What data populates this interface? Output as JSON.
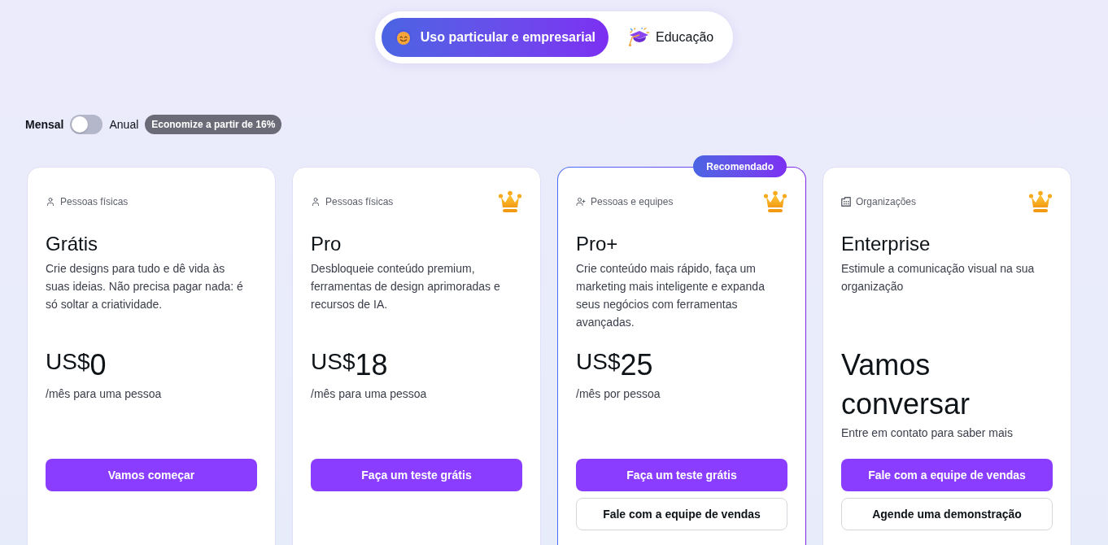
{
  "segments": [
    {
      "kind": "smiley",
      "label": "Uso particular e empresarial",
      "selected": true
    },
    {
      "kind": "graduation",
      "label": "Educação",
      "selected": false
    }
  ],
  "billing": {
    "left_label": "Mensal",
    "on": false,
    "right_label": "Anual",
    "badge": "Economize a partir de 16%"
  },
  "plans": [
    {
      "audience": {
        "kind": "person",
        "label": "Pessoas físicas"
      },
      "crown": false,
      "recommended": false,
      "name": "Grátis",
      "description": "Crie designs para tudo e dê vida às suas ideias. Não precisa pagar nada: é só soltar a criatividade.",
      "price": {
        "kind": "amount",
        "currency": "US$",
        "amount": "0"
      },
      "note": "/mês para uma pessoa",
      "buttons": [
        {
          "kind": "primary",
          "label": "Vamos começar"
        }
      ]
    },
    {
      "audience": {
        "kind": "person",
        "label": "Pessoas físicas"
      },
      "crown": true,
      "recommended": false,
      "name": "Pro",
      "description": "Desbloqueie conteúdo premium, ferramentas de design aprimoradas e recursos de IA.",
      "price": {
        "kind": "amount",
        "currency": "US$",
        "amount": "18"
      },
      "note": "/mês para uma pessoa",
      "buttons": [
        {
          "kind": "primary",
          "label": "Faça um teste grátis"
        }
      ]
    },
    {
      "badge": "Recomendado",
      "audience": {
        "kind": "person-plus",
        "label": "Pessoas e equipes"
      },
      "crown": true,
      "recommended": true,
      "name": "Pro+",
      "description": "Crie conteúdo mais rápido, faça um marketing mais inteligente e expanda seus negócios com ferramentas avançadas.",
      "price": {
        "kind": "amount",
        "currency": "US$",
        "amount": "25"
      },
      "note": "/mês por pessoa",
      "buttons": [
        {
          "kind": "primary",
          "label": "Faça um teste grátis"
        },
        {
          "kind": "secondary",
          "label": "Fale com a equipe de vendas"
        }
      ]
    },
    {
      "audience": {
        "kind": "building",
        "label": "Organizações"
      },
      "crown": true,
      "recommended": false,
      "name": "Enterprise",
      "description": "Estimule a comunicação visual na sua organização",
      "price": {
        "kind": "text",
        "text": "Vamos conversar"
      },
      "note": "Entre em contato para saber mais",
      "buttons": [
        {
          "kind": "primary",
          "label": "Fale com a equipe de vendas"
        },
        {
          "kind": "secondary",
          "label": "Agende uma demonstração"
        }
      ]
    }
  ]
}
